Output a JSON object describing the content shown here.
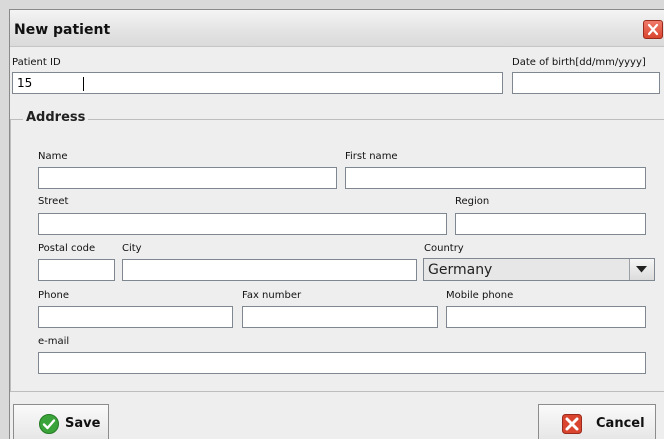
{
  "window": {
    "title": "New patient"
  },
  "patient": {
    "id_label": "Patient ID",
    "id_value": "15",
    "dob_label": "Date of birth[dd/mm/yyyy]",
    "dob_value": ""
  },
  "address": {
    "group_title": "Address",
    "name_label": "Name",
    "first_name_label": "First name",
    "street_label": "Street",
    "region_label": "Region",
    "postal_code_label": "Postal code",
    "city_label": "City",
    "country_label": "Country",
    "country_value": "Germany",
    "phone_label": "Phone",
    "fax_label": "Fax number",
    "mobile_label": "Mobile phone",
    "email_label": "e-mail"
  },
  "buttons": {
    "save_label": "Save",
    "cancel_label": "Cancel"
  },
  "icons": {
    "close": "close-icon",
    "save": "checkmark-icon",
    "cancel": "cancel-x-icon",
    "dropdown": "chevron-down-icon"
  },
  "colors": {
    "close_button": "#d9452e",
    "save_icon": "#3aa33a",
    "cancel_icon": "#d9452e"
  }
}
